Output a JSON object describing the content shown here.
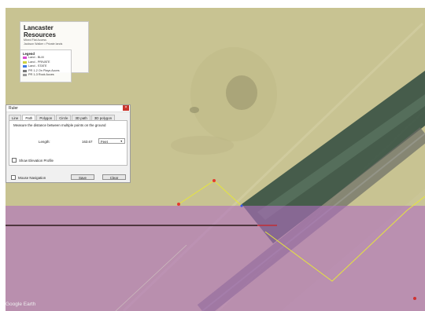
{
  "legend_panel": {
    "title": "Lancaster Resources",
    "subtitle_1": "Mixed Flat Access",
    "subtitle_2": "Jackson Walker • Private lands"
  },
  "legend": {
    "heading": "Legend",
    "items": [
      {
        "label": "Land - BLM",
        "color": "#d94ad1"
      },
      {
        "label": "Land - PRIVATE",
        "color": "#cfd33f"
      },
      {
        "label": "Land - STATE",
        "color": "#3f79e0"
      },
      {
        "label": "PR 1-2 On Plays Acces",
        "color": "#7a7a7a"
      },
      {
        "label": "PR 1-3 Rock Acces",
        "color": "#9a9a9a"
      }
    ]
  },
  "ruler": {
    "title": "Ruler",
    "close_glyph": "×",
    "tabs": [
      "Line",
      "Path",
      "Polygon",
      "Circle",
      "3D path",
      "3D polygon"
    ],
    "active_tab": "Path",
    "description": "Measure the distance between multiple points on the ground",
    "length_label": "Length:",
    "length_value": "163.67",
    "unit": "Feet",
    "show_elevation_label": "Show Elevation Profile",
    "mouse_nav_label": "Mouse Navigation",
    "save_label": "Save",
    "clear_label": "Clear"
  },
  "watermark": "Google Earth",
  "colors": {
    "private_overlay": "#cfc990",
    "blm_overlay": "#b97bc2",
    "path_color": "#e6e63c",
    "point_color": "#e63b2e"
  }
}
